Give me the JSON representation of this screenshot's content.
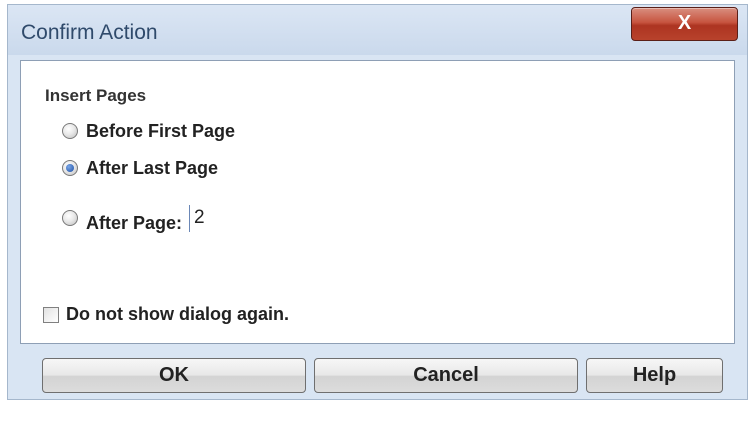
{
  "dialog": {
    "title": "Confirm Action",
    "close_label": "X"
  },
  "insert_pages": {
    "group_label": "Insert Pages",
    "options": [
      {
        "label": "Before First Page",
        "selected": false
      },
      {
        "label": "After Last Page",
        "selected": true
      },
      {
        "label": "After Page:",
        "selected": false
      }
    ],
    "page_number_value": "2"
  },
  "dont_show_again": {
    "label": "Do not show dialog again.",
    "checked": false
  },
  "buttons": {
    "ok": "OK",
    "cancel": "Cancel",
    "help": "Help"
  },
  "colors": {
    "window_frame": "#d9e5f3",
    "title_text": "#2f4a6b",
    "close_button": "#b8422c"
  }
}
